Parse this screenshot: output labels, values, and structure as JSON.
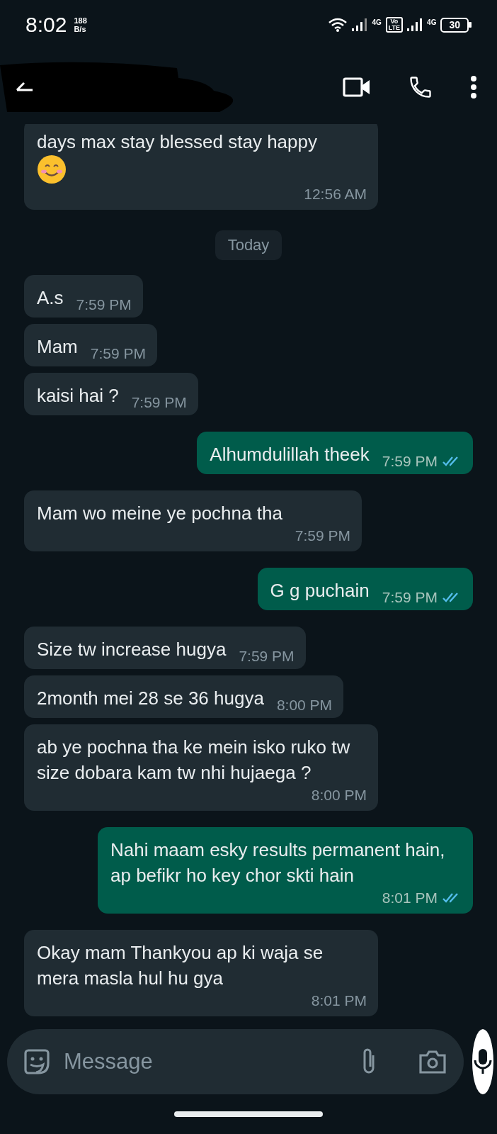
{
  "status_bar": {
    "time": "8:02",
    "speed_value": "188",
    "speed_unit": "B/s",
    "network_1": "4G",
    "volte_top": "Vo",
    "volte_bottom": "LTE",
    "network_2": "4G",
    "battery": "30"
  },
  "header": {
    "name_redacted": true
  },
  "date_chip": "Today",
  "messages": [
    {
      "outgoing": false,
      "text": "days max stay blessed stay happy",
      "smile_emoji": true,
      "time": "12:56 AM",
      "meta_below": true,
      "read": false
    },
    {
      "outgoing": false,
      "text": "A.s",
      "time": "7:59 PM",
      "meta_below": false,
      "read": false
    },
    {
      "outgoing": false,
      "text": "Mam",
      "time": "7:59 PM",
      "meta_below": false,
      "read": false
    },
    {
      "outgoing": false,
      "text": "kaisi hai ?",
      "time": "7:59 PM",
      "meta_below": false,
      "read": false
    },
    {
      "outgoing": true,
      "text": "Alhumdulillah theek",
      "time": "7:59 PM",
      "meta_below": false,
      "read": true
    },
    {
      "outgoing": false,
      "text": "Mam wo meine ye pochna tha",
      "time": "7:59 PM",
      "meta_below": true,
      "read": false
    },
    {
      "outgoing": true,
      "text": "G g puchain",
      "time": "7:59 PM",
      "meta_below": false,
      "read": true
    },
    {
      "outgoing": false,
      "text": "Size tw increase hugya",
      "time": "7:59 PM",
      "meta_below": false,
      "read": false
    },
    {
      "outgoing": false,
      "text": "2month mei 28 se 36 hugya",
      "time": "8:00 PM",
      "meta_below": false,
      "read": false
    },
    {
      "outgoing": false,
      "text": "ab ye pochna tha ke mein isko ruko tw size dobara kam tw nhi hujaega ?",
      "time": "8:00 PM",
      "meta_below": true,
      "read": false
    },
    {
      "outgoing": true,
      "text": "Nahi maam esky results permanent hain, ap befikr ho key chor skti hain",
      "time": "8:01 PM",
      "meta_below": true,
      "read": true
    },
    {
      "outgoing": false,
      "text": "Okay mam Thankyou ap ki waja se mera masla hul hu gya",
      "time": "8:01 PM",
      "meta_below": true,
      "read": false
    }
  ],
  "composer": {
    "placeholder": "Message"
  }
}
